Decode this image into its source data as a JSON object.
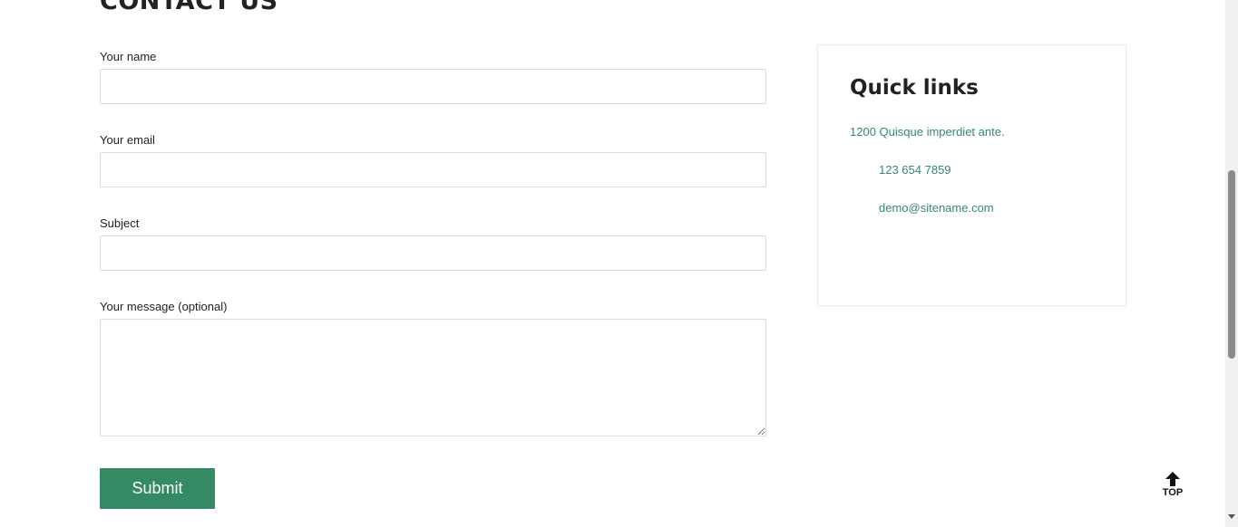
{
  "page": {
    "heading": "CONTACT US"
  },
  "form": {
    "name_label": "Your name",
    "name_value": "",
    "email_label": "Your email",
    "email_value": "",
    "subject_label": "Subject",
    "subject_value": "",
    "message_label": "Your message (optional)",
    "message_value": "",
    "submit_label": "Submit"
  },
  "quick_links": {
    "title": "Quick links",
    "address": "1200 Quisque imperdiet ante.",
    "phone": "123 654 7859",
    "email": "demo@sitename.com"
  },
  "back_to_top": {
    "label": "TOP",
    "icon": "arrow-up-icon"
  },
  "colors": {
    "accent": "#348a63",
    "link": "#348a63",
    "border": "#d9d9d9",
    "text": "#222222"
  }
}
